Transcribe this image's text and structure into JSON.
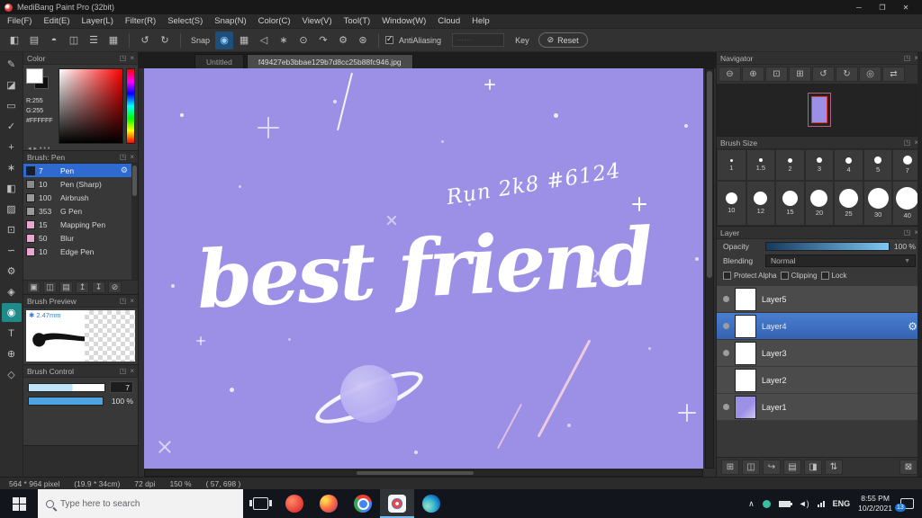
{
  "colors": {
    "canvas_bg": "#9b8fe6",
    "accent_blue": "#3579d8",
    "selected_layer_bg": "#3566b5",
    "selected_brush_bg": "#2f6ad0"
  },
  "titlebar": {
    "title": "MediBang Paint Pro (32bit)"
  },
  "menubar": {
    "items": [
      "File(F)",
      "Edit(E)",
      "Layer(L)",
      "Filter(R)",
      "Select(S)",
      "Snap(N)",
      "Color(C)",
      "View(V)",
      "Tool(T)",
      "Window(W)",
      "Cloud",
      "Help"
    ]
  },
  "toolbar": {
    "snap_label": "Snap",
    "antialiasing_label": "AntiAliasing",
    "key_label": "Key",
    "reset_label": "Reset"
  },
  "tabs": {
    "untitled": "Untitled",
    "image": "f49427eb3bbae129b7d8cc25b88fc946.jpg"
  },
  "color_panel": {
    "title": "Color",
    "r": "R:255",
    "g": "G:255",
    "hex": "#FFFFFF"
  },
  "brush_panel": {
    "title": "Brush: Pen",
    "brushes": [
      {
        "size": "7",
        "name": "Pen",
        "swatch": "#16202e",
        "selected": true
      },
      {
        "size": "10",
        "name": "Pen (Sharp)",
        "swatch": "#8a8a8a"
      },
      {
        "size": "100",
        "name": "Airbrush",
        "swatch": "#9a9a9a"
      },
      {
        "size": "353",
        "name": "G Pen",
        "swatch": "#9a9a9a"
      },
      {
        "size": "15",
        "name": "Mapping Pen",
        "swatch": "#e9a8cf"
      },
      {
        "size": "50",
        "name": "Blur",
        "swatch": "#e9a8cf"
      },
      {
        "size": "10",
        "name": "Edge Pen",
        "swatch": "#e9a8cf"
      }
    ]
  },
  "brush_preview": {
    "title": "Brush Preview",
    "size_label": "2.47mm"
  },
  "brush_control": {
    "title": "Brush Control",
    "size_value": "7",
    "opacity_value": "100 %"
  },
  "navigator": {
    "title": "Navigator"
  },
  "brush_size": {
    "title": "Brush Size",
    "sizes": [
      "1",
      "1.5",
      "2",
      "3",
      "4",
      "5",
      "7",
      "10",
      "12",
      "15",
      "20",
      "25",
      "30",
      "40"
    ]
  },
  "layer_panel": {
    "title": "Layer",
    "opacity_label": "Opacity",
    "opacity_value": "100 %",
    "blending_label": "Blending",
    "blending_value": "Normal",
    "protect_alpha_label": "Protect Alpha",
    "clipping_label": "Clipping",
    "lock_label": "Lock",
    "layers": [
      {
        "name": "Layer5",
        "visible": true
      },
      {
        "name": "Layer4",
        "visible": true,
        "selected": true
      },
      {
        "name": "Layer3",
        "visible": true
      },
      {
        "name": "Layer2",
        "visible": false
      },
      {
        "name": "Layer1",
        "visible": true
      }
    ]
  },
  "canvas": {
    "title_text": "best friend",
    "caption_text": "Run 2k8 #6124"
  },
  "statusbar": {
    "size": "564 * 964 pixel",
    "dimensions": "(19.9 * 34cm)",
    "dpi": "72 dpi",
    "zoom": "150 %",
    "coords": "( 57, 698 )"
  },
  "taskbar": {
    "search_placeholder": "Type here to search",
    "language": "ENG",
    "time": "8:55 PM",
    "date": "10/2/2021",
    "notification_count": "13"
  }
}
